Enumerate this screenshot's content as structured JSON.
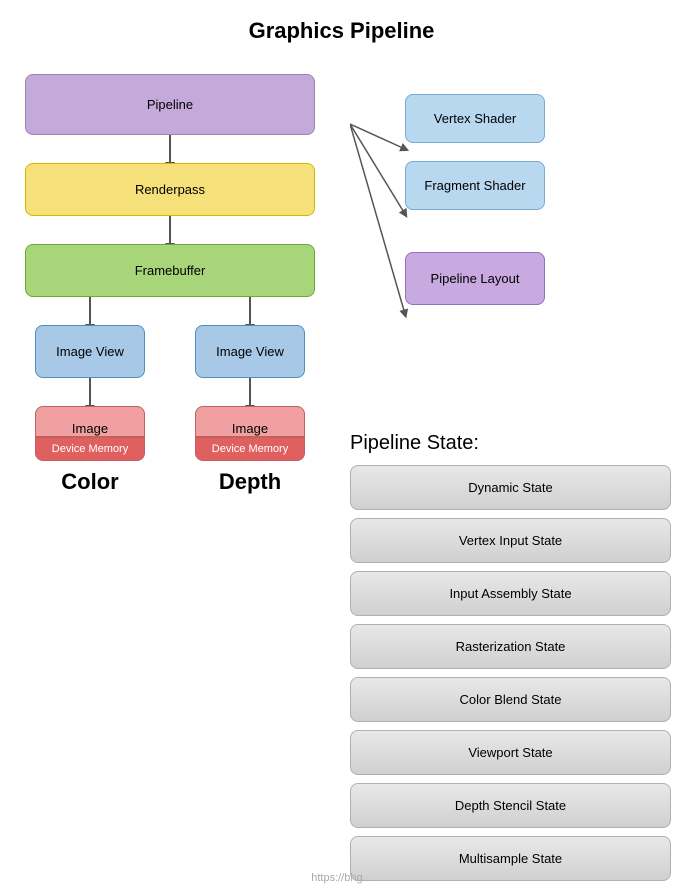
{
  "title": "Graphics Pipeline",
  "left": {
    "pipeline_label": "Pipeline",
    "renderpass_label": "Renderpass",
    "framebuffer_label": "Framebuffer",
    "image_view_label": "Image View",
    "image_label": "Image",
    "device_memory_label": "Device Memory",
    "color_label": "Color",
    "depth_label": "Depth"
  },
  "right": {
    "vertex_shader_label": "Vertex Shader",
    "fragment_shader_label": "Fragment Shader",
    "pipeline_layout_label": "Pipeline Layout",
    "pipeline_state_title": "Pipeline State:",
    "states": [
      "Dynamic State",
      "Vertex Input State",
      "Input Assembly State",
      "Rasterization State",
      "Color Blend State",
      "Viewport State",
      "Depth Stencil State",
      "Multisample State"
    ]
  },
  "watermark": "https://bhg..."
}
